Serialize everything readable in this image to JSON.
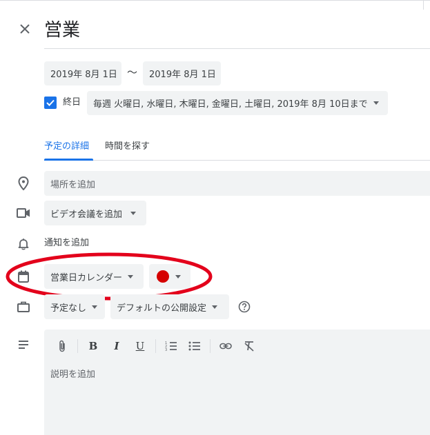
{
  "event": {
    "title": "営業"
  },
  "dates": {
    "start": "2019年 8月 1日",
    "separator": "〜",
    "end": "2019年 8月 1日"
  },
  "all_day": {
    "checked": true,
    "label": "終日"
  },
  "recurrence": {
    "value": "毎週 火曜日, 水曜日, 木曜日, 金曜日, 土曜日, 2019年 8月 10日まで"
  },
  "tabs": [
    {
      "label": "予定の詳細",
      "active": true
    },
    {
      "label": "時間を探す",
      "active": false
    }
  ],
  "location": {
    "placeholder": "場所を追加"
  },
  "video": {
    "label": "ビデオ会議を追加"
  },
  "notification": {
    "label": "通知を追加"
  },
  "calendar": {
    "label": "営業日カレンダー",
    "color": "#d50000"
  },
  "availability": {
    "label": "予定なし"
  },
  "visibility": {
    "label": "デフォルトの公開設定"
  },
  "description": {
    "placeholder": "説明を追加"
  },
  "toolbar": {
    "bold": "B",
    "italic": "I",
    "underline": "U"
  },
  "colors": {
    "accent": "#1a73e8",
    "annotation": "#e3001b",
    "chip_bg": "#f1f3f4"
  }
}
